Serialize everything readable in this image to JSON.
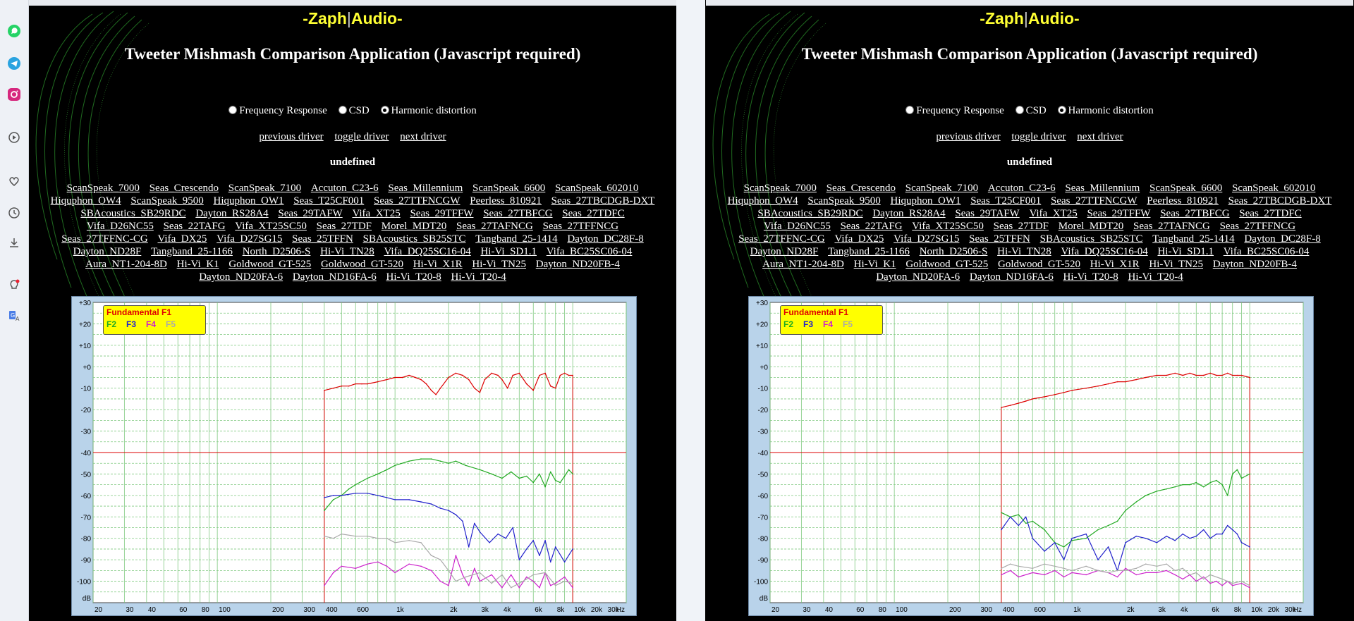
{
  "sidebar": {
    "icons": [
      "whatsapp-icon",
      "telegram-icon",
      "instagram-icon",
      "play-circle-icon",
      "heart-icon",
      "clock-icon",
      "download-icon",
      "lightbulb-icon",
      "translate-icon"
    ]
  },
  "page": {
    "logo_left": "-Zaph",
    "logo_sep": "|",
    "logo_right": "Audio-",
    "title": "Tweeter Mishmash Comparison Application (Javascript required)",
    "modes": [
      "Frequency Response",
      "CSD",
      "Harmonic distortion"
    ],
    "selected_mode": "Harmonic distortion",
    "nav": {
      "prev": "previous driver",
      "toggle": "toggle driver",
      "next": "next driver"
    },
    "undefined_label": "undefined",
    "drivers": [
      "ScanSpeak_7000",
      "Seas_Crescendo",
      "ScanSpeak_7100",
      "Accuton_C23-6",
      "Seas_Millennium",
      "ScanSpeak_6600",
      "ScanSpeak_602010",
      "Hiquphon_OW4",
      "ScanSpeak_9500",
      "Hiquphon_OW1",
      "Seas_T25CF001",
      "Seas_27TTFNCGW",
      "Peerless_810921",
      "Seas_27TBCDGB-DXT",
      "SBAcoustics_SB29RDC",
      "Dayton_RS28A4",
      "Seas_29TAFW",
      "Vifa_XT25",
      "Seas_29TFFW",
      "Seas_27TBFCG",
      "Seas_27TDFC",
      "Vifa_D26NC55",
      "Seas_22TAFG",
      "Vifa_XT25SC50",
      "Seas_27TDF",
      "Morel_MDT20",
      "Seas_27TAFNCG",
      "Seas_27TFFNCG",
      "Seas_27TFFNC-CG",
      "Vifa_DX25",
      "Vifa_D27SG15",
      "Seas_25TFFN",
      "SBAcoustics_SB25STC",
      "Tangband_25-1414",
      "Dayton_DC28F-8",
      "Dayton_ND28F",
      "Tangband_25-1166",
      "North_D2506-S",
      "Hi-Vi_TN28",
      "Vifa_DQ25SC16-04",
      "Hi-Vi_SD1.1",
      "Vifa_BC25SC06-04",
      "Aura_NT1-204-8D",
      "Hi-Vi_K1",
      "Goldwood_GT-525",
      "Goldwood_GT-520",
      "Hi-Vi_X1R",
      "Hi-Vi_TN25",
      "Dayton_ND20FB-4",
      "Dayton_ND20FA-6",
      "Dayton_ND16FA-6",
      "Hi-Vi_T20-8",
      "Hi-Vi_T20-4"
    ]
  },
  "legend": {
    "fundamental": "Fundamental F1",
    "harmonics": [
      "F2",
      "F3",
      "F4",
      "F5"
    ]
  },
  "colors": {
    "f1": "#dd0000",
    "f2": "#22aa22",
    "f3": "#2222cc",
    "f4": "#cc22cc",
    "f5": "#aaaaaa",
    "reference": "#dd0000",
    "accent": "#ffff33"
  },
  "chart_data": [
    {
      "type": "line",
      "log_x": true,
      "xlim": [
        20,
        20000
      ],
      "ylim": [
        -110,
        30
      ],
      "x_ticks": [
        20,
        30,
        40,
        60,
        80,
        100,
        200,
        300,
        400,
        600,
        1000,
        2000,
        3000,
        4000,
        6000,
        8000,
        10000,
        20000,
        20000
      ],
      "x_tick_labels": [
        "20",
        "30",
        "40",
        "60",
        "80",
        "100",
        "200",
        "300",
        "400",
        "600",
        "1k",
        "2k",
        "3k",
        "4k",
        "6k",
        "8k",
        "10k",
        "20k",
        "30k"
      ],
      "x_unit": "Hz",
      "y_ticks": [
        30,
        20,
        10,
        0,
        -10,
        -20,
        -30,
        -40,
        -50,
        -60,
        -70,
        -80,
        -90,
        -100
      ],
      "y_tick_labels": [
        "+30",
        "+20",
        "+10",
        "+0",
        "-10",
        "-20",
        "-30",
        "-40",
        "-50",
        "-60",
        "-70",
        "-80",
        "-90",
        "-100"
      ],
      "y_unit": "dB",
      "reference_level": -40,
      "series": [
        {
          "name": "Fundamental F1",
          "color": "#dd0000",
          "x": [
            400,
            450,
            500,
            550,
            600,
            650,
            700,
            800,
            900,
            1000,
            1100,
            1200,
            1300,
            1400,
            1500,
            1600,
            1700,
            1800,
            2000,
            2200,
            2400,
            2600,
            2800,
            3000,
            3200,
            3500,
            3800,
            4000,
            4300,
            4600,
            5000,
            5500,
            6000,
            6500,
            7000,
            7500,
            8000,
            8500,
            9000,
            9500,
            10000
          ],
          "y": [
            -11,
            -10,
            -9,
            -9,
            -8,
            -8,
            -8,
            -7,
            -6,
            -5,
            -5,
            -4,
            -5,
            -6,
            -8,
            -11,
            -13,
            -10,
            -5,
            -3,
            -4,
            -6,
            -10,
            -12,
            -6,
            -3,
            -4,
            -6,
            -10,
            -4,
            -3,
            -8,
            -11,
            -4,
            -3,
            -9,
            -10,
            -4,
            -3,
            -4,
            -4
          ]
        },
        {
          "name": "F2",
          "color": "#22aa22",
          "x": [
            400,
            450,
            500,
            550,
            600,
            700,
            800,
            900,
            1000,
            1200,
            1400,
            1600,
            1800,
            2000,
            2200,
            2500,
            3000,
            3500,
            4000,
            4500,
            5000,
            5500,
            6000,
            6500,
            7000,
            7500,
            8000,
            8500,
            9000,
            9500,
            10000
          ],
          "y": [
            -67,
            -62,
            -60,
            -57,
            -55,
            -52,
            -50,
            -48,
            -46,
            -44,
            -43,
            -43,
            -44,
            -45,
            -44,
            -46,
            -48,
            -50,
            -52,
            -49,
            -52,
            -51,
            -54,
            -50,
            -56,
            -49,
            -53,
            -54,
            -51,
            -48,
            -50
          ]
        },
        {
          "name": "F3",
          "color": "#2222cc",
          "x": [
            400,
            450,
            500,
            600,
            700,
            800,
            900,
            1000,
            1200,
            1400,
            1600,
            1800,
            2000,
            2200,
            2400,
            2600,
            2800,
            3000,
            3400,
            3800,
            4200,
            4600,
            5000,
            5500,
            6000,
            6500,
            7000,
            7500,
            8000,
            9000,
            10000
          ],
          "y": [
            -61,
            -60,
            -60,
            -59,
            -59,
            -60,
            -61,
            -62,
            -62,
            -63,
            -64,
            -66,
            -67,
            -69,
            -72,
            -84,
            -73,
            -77,
            -82,
            -78,
            -80,
            -75,
            -90,
            -85,
            -81,
            -88,
            -81,
            -91,
            -84,
            -91,
            -85
          ]
        },
        {
          "name": "F4",
          "color": "#cc22cc",
          "x": [
            400,
            450,
            500,
            600,
            700,
            800,
            900,
            1000,
            1200,
            1400,
            1600,
            1800,
            2000,
            2200,
            2400,
            2600,
            2800,
            3000,
            3500,
            4000,
            4500,
            5000,
            5500,
            6000,
            6500,
            7000,
            7500,
            8000,
            9000,
            10000
          ],
          "y": [
            -102,
            -96,
            -93,
            -94,
            -92,
            -91,
            -93,
            -96,
            -92,
            -93,
            -95,
            -100,
            -102,
            -88,
            -97,
            -102,
            -94,
            -100,
            -97,
            -103,
            -97,
            -103,
            -98,
            -100,
            -103,
            -96,
            -102,
            -101,
            -98,
            -103
          ]
        },
        {
          "name": "F5",
          "color": "#aaaaaa",
          "x": [
            400,
            450,
            500,
            600,
            700,
            800,
            900,
            1000,
            1200,
            1400,
            1600,
            1800,
            2000,
            2200,
            2500,
            3000,
            3500,
            4000,
            4500,
            5000,
            5500,
            6000,
            7000,
            8000,
            9000,
            10000
          ],
          "y": [
            -79,
            -80,
            -78,
            -79,
            -79,
            -80,
            -80,
            -82,
            -81,
            -82,
            -88,
            -90,
            -95,
            -100,
            -98,
            -96,
            -101,
            -97,
            -103,
            -101,
            -99,
            -97,
            -96,
            -102,
            -100,
            -101
          ]
        }
      ]
    },
    {
      "type": "line",
      "log_x": true,
      "xlim": [
        20,
        20000
      ],
      "ylim": [
        -110,
        30
      ],
      "x_ticks": [
        20,
        30,
        40,
        60,
        80,
        100,
        200,
        300,
        400,
        600,
        1000,
        2000,
        3000,
        4000,
        6000,
        8000,
        10000,
        20000,
        20000
      ],
      "x_tick_labels": [
        "20",
        "30",
        "40",
        "60",
        "80",
        "100",
        "200",
        "300",
        "400",
        "600",
        "1k",
        "2k",
        "3k",
        "4k",
        "6k",
        "8k",
        "10k",
        "20k",
        "30k"
      ],
      "x_unit": "Hz",
      "y_ticks": [
        30,
        20,
        10,
        0,
        -10,
        -20,
        -30,
        -40,
        -50,
        -60,
        -70,
        -80,
        -90,
        -100
      ],
      "y_tick_labels": [
        "+30",
        "+20",
        "+10",
        "+0",
        "-10",
        "-20",
        "-30",
        "-40",
        "-50",
        "-60",
        "-70",
        "-80",
        "-90",
        "-100"
      ],
      "y_unit": "dB",
      "reference_level": -40,
      "series": [
        {
          "name": "Fundamental F1",
          "color": "#dd0000",
          "x": [
            400,
            450,
            500,
            550,
            600,
            700,
            800,
            900,
            1000,
            1200,
            1400,
            1600,
            1800,
            2000,
            2300,
            2600,
            3000,
            3400,
            3800,
            4200,
            4600,
            5000,
            5500,
            6000,
            6500,
            7000,
            7500,
            8000,
            8500,
            9000,
            10000
          ],
          "y": [
            -19,
            -18,
            -17,
            -16,
            -15,
            -14,
            -13,
            -12,
            -11,
            -10,
            -9,
            -8,
            -7,
            -7,
            -6,
            -5,
            -4,
            -4,
            -3,
            -4,
            -3,
            -4,
            -4,
            -3,
            -4,
            -4,
            -3,
            -4,
            -4,
            -4,
            -5
          ]
        },
        {
          "name": "F2",
          "color": "#22aa22",
          "x": [
            400,
            450,
            500,
            550,
            600,
            700,
            800,
            900,
            1000,
            1200,
            1400,
            1600,
            1800,
            2000,
            2300,
            2600,
            3000,
            3400,
            3800,
            4200,
            4600,
            5000,
            5500,
            6000,
            6500,
            7000,
            7500,
            8000,
            8500,
            9000,
            10000
          ],
          "y": [
            -68,
            -70,
            -69,
            -73,
            -72,
            -76,
            -82,
            -84,
            -81,
            -80,
            -76,
            -74,
            -72,
            -67,
            -63,
            -60,
            -58,
            -57,
            -56,
            -55,
            -55,
            -54,
            -56,
            -54,
            -53,
            -55,
            -60,
            -50,
            -48,
            -52,
            -50
          ]
        },
        {
          "name": "F3",
          "color": "#2222cc",
          "x": [
            400,
            450,
            500,
            550,
            600,
            700,
            800,
            900,
            1000,
            1200,
            1400,
            1600,
            1800,
            2000,
            2300,
            2600,
            3000,
            3400,
            3800,
            4200,
            4600,
            5000,
            5500,
            6000,
            6500,
            7000,
            7500,
            8000,
            8500,
            9000,
            10000
          ],
          "y": [
            -76,
            -70,
            -74,
            -70,
            -80,
            -86,
            -82,
            -90,
            -80,
            -78,
            -90,
            -84,
            -95,
            -82,
            -79,
            -80,
            -82,
            -79,
            -81,
            -78,
            -80,
            -79,
            -76,
            -80,
            -78,
            -78,
            -74,
            -76,
            -78,
            -82,
            -84
          ]
        },
        {
          "name": "F4",
          "color": "#cc22cc",
          "x": [
            400,
            450,
            500,
            600,
            700,
            800,
            900,
            1000,
            1200,
            1400,
            1600,
            1800,
            2000,
            2300,
            2600,
            3000,
            3400,
            3800,
            4200,
            4600,
            5000,
            5500,
            6000,
            6500,
            7000,
            7500,
            8000,
            9000,
            10000
          ],
          "y": [
            -97,
            -95,
            -98,
            -96,
            -97,
            -95,
            -98,
            -96,
            -97,
            -95,
            -96,
            -98,
            -94,
            -97,
            -96,
            -96,
            -95,
            -97,
            -99,
            -97,
            -100,
            -98,
            -101,
            -100,
            -102,
            -100,
            -102,
            -101,
            -103
          ]
        },
        {
          "name": "F5",
          "color": "#aaaaaa",
          "x": [
            400,
            450,
            500,
            600,
            700,
            800,
            900,
            1000,
            1200,
            1400,
            1600,
            1800,
            2000,
            2300,
            2600,
            3000,
            3400,
            3800,
            4200,
            4600,
            5000,
            5500,
            6000,
            7000,
            8000,
            9000,
            10000
          ],
          "y": [
            -94,
            -92,
            -93,
            -94,
            -92,
            -93,
            -94,
            -95,
            -93,
            -95,
            -96,
            -95,
            -95,
            -94,
            -92,
            -93,
            -92,
            -95,
            -94,
            -97,
            -96,
            -99,
            -97,
            -99,
            -101,
            -100,
            -102
          ]
        }
      ]
    }
  ]
}
